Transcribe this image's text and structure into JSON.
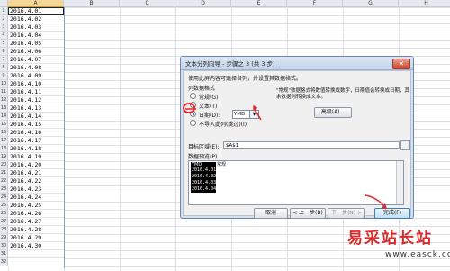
{
  "sheet": {
    "columns": [
      "A",
      "B",
      "C",
      "D",
      "E",
      "F",
      "G",
      "H"
    ],
    "rows": [
      "1",
      "2",
      "3",
      "4",
      "5",
      "6",
      "7",
      "8",
      "9",
      "10",
      "11",
      "12",
      "13",
      "14",
      "15",
      "16",
      "17",
      "18",
      "19",
      "20",
      "21",
      "22",
      "23",
      "24",
      "25",
      "26",
      "27",
      "28",
      "29",
      "30",
      "31",
      "32"
    ],
    "colA": [
      "2016.4.01",
      "2016.4.02",
      "2016.4.03",
      "2016.4.04",
      "2016.4.05",
      "2016.4.06",
      "2016.4.07",
      "2016.4.08",
      "2016.4.09",
      "2016.4.10",
      "2016.4.11",
      "2016.4.12",
      "2016.4.13",
      "2016.4.14",
      "2016.4.15",
      "2016.4.16",
      "2016.4.17",
      "2016.4.18",
      "2016.4.19",
      "2016.4.20",
      "2016.4.21",
      "2016.4.22",
      "2016.4.23",
      "2016.4.24",
      "2016.4.25",
      "2016.4.26",
      "2016.4.27",
      "2016.4.28",
      "2016.4.29",
      "2016.4.30",
      "",
      ""
    ]
  },
  "dialog": {
    "title": "文本分列向导 - 步骤之 3 (共 3 步)",
    "close": "✕",
    "intro": "使用此屏内容可选择各列，并设置其数据格式。",
    "group_label": "列数据格式",
    "options": {
      "general": "常规(G)",
      "text": "文本(T)",
      "date": "日期(D):",
      "skip": "不导入此列(跳过)(I)"
    },
    "date_format": "YMD",
    "note": "\"常规\"数据格式将数值转换成数字，日期值会转换成日期，其余数据则转换成文本。",
    "advanced_btn": "高级(A)...",
    "target_label": "目标区域(E):",
    "target_value": "$A$1",
    "preview_label": "数据预览(P)",
    "preview": {
      "col1_header": "YMD",
      "col2_header": "常规",
      "rows": [
        "2016.4.01",
        "2016.4.02",
        "2016.4.03",
        "2016.4.04"
      ]
    },
    "buttons": {
      "cancel": "取消",
      "back": "< 上一步(B)",
      "next": "下一步(N) >",
      "finish": "完成(F)"
    }
  },
  "watermark": {
    "cn": "易采站长站",
    "url": "www.easck.com"
  },
  "colors": {
    "dialog_bg": "#d5e1f1",
    "annotation": "#e3262b",
    "watermark": "#d92a2a"
  }
}
